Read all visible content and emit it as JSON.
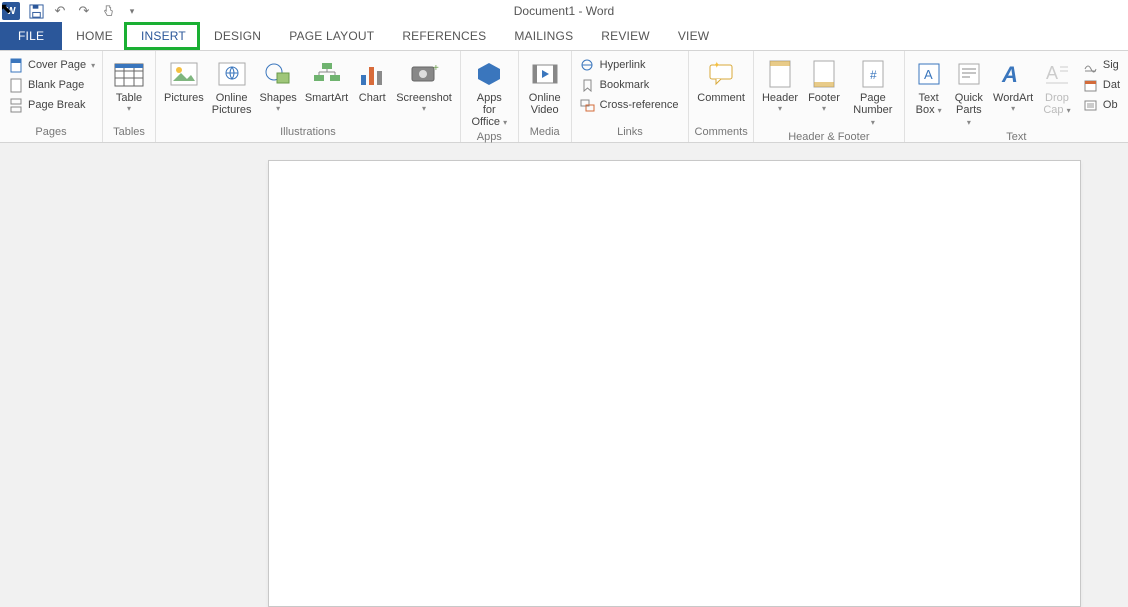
{
  "title": "Document1 - Word",
  "qat": {
    "save_icon": "💾",
    "undo_icon": "↶",
    "redo_icon": "↷",
    "touch_icon": "✋"
  },
  "tabs": {
    "file": "FILE",
    "home": "HOME",
    "insert": "INSERT",
    "design": "DESIGN",
    "page_layout": "PAGE LAYOUT",
    "references": "REFERENCES",
    "mailings": "MAILINGS",
    "review": "REVIEW",
    "view": "VIEW"
  },
  "groups": {
    "pages": {
      "label": "Pages",
      "cover_page": "Cover Page",
      "blank_page": "Blank Page",
      "page_break": "Page Break"
    },
    "tables": {
      "label": "Tables",
      "table": "Table"
    },
    "illustrations": {
      "label": "Illustrations",
      "pictures": "Pictures",
      "online_pictures_l1": "Online",
      "online_pictures_l2": "Pictures",
      "shapes": "Shapes",
      "smartart": "SmartArt",
      "chart": "Chart",
      "screenshot": "Screenshot"
    },
    "apps": {
      "label": "Apps",
      "apps_for_l1": "Apps for",
      "apps_for_l2": "Office"
    },
    "media": {
      "label": "Media",
      "online_video_l1": "Online",
      "online_video_l2": "Video"
    },
    "links": {
      "label": "Links",
      "hyperlink": "Hyperlink",
      "bookmark": "Bookmark",
      "cross_ref": "Cross-reference"
    },
    "comments": {
      "label": "Comments",
      "comment": "Comment"
    },
    "header_footer": {
      "label": "Header & Footer",
      "header": "Header",
      "footer": "Footer",
      "page_number_l1": "Page",
      "page_number_l2": "Number"
    },
    "text": {
      "label": "Text",
      "text_box_l1": "Text",
      "text_box_l2": "Box",
      "quick_parts_l1": "Quick",
      "quick_parts_l2": "Parts",
      "wordart": "WordArt",
      "drop_cap_l1": "Drop",
      "drop_cap_l2": "Cap",
      "signature": "Sig",
      "date": "Dat",
      "object": "Ob"
    }
  },
  "dropdown_glyph": "▾"
}
